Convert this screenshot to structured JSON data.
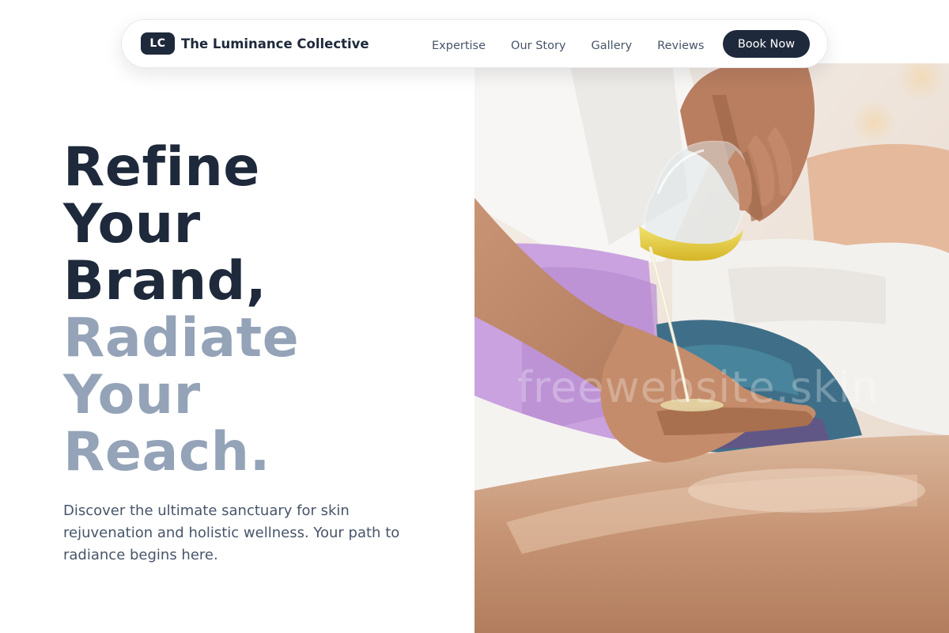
{
  "brand": {
    "logo_text": "LC",
    "name": "The Luminance Collective"
  },
  "nav": {
    "links": [
      {
        "label": "Expertise"
      },
      {
        "label": "Our Story"
      },
      {
        "label": "Gallery"
      },
      {
        "label": "Reviews"
      }
    ],
    "cta_label": "Book Now"
  },
  "hero": {
    "headline_dark": [
      "Refine",
      "Your",
      "Brand,"
    ],
    "headline_light": [
      "Radiate",
      "Your",
      "Reach."
    ],
    "description": "Discover the ultimate sanctuary for skin rejuvenation and holistic wellness. Your path to radiance begins here.",
    "watermark": "freewebsite.skin"
  },
  "colors": {
    "primary_dark": "#1e293b",
    "headline_muted": "#94a3b8",
    "body_text": "#475569"
  }
}
